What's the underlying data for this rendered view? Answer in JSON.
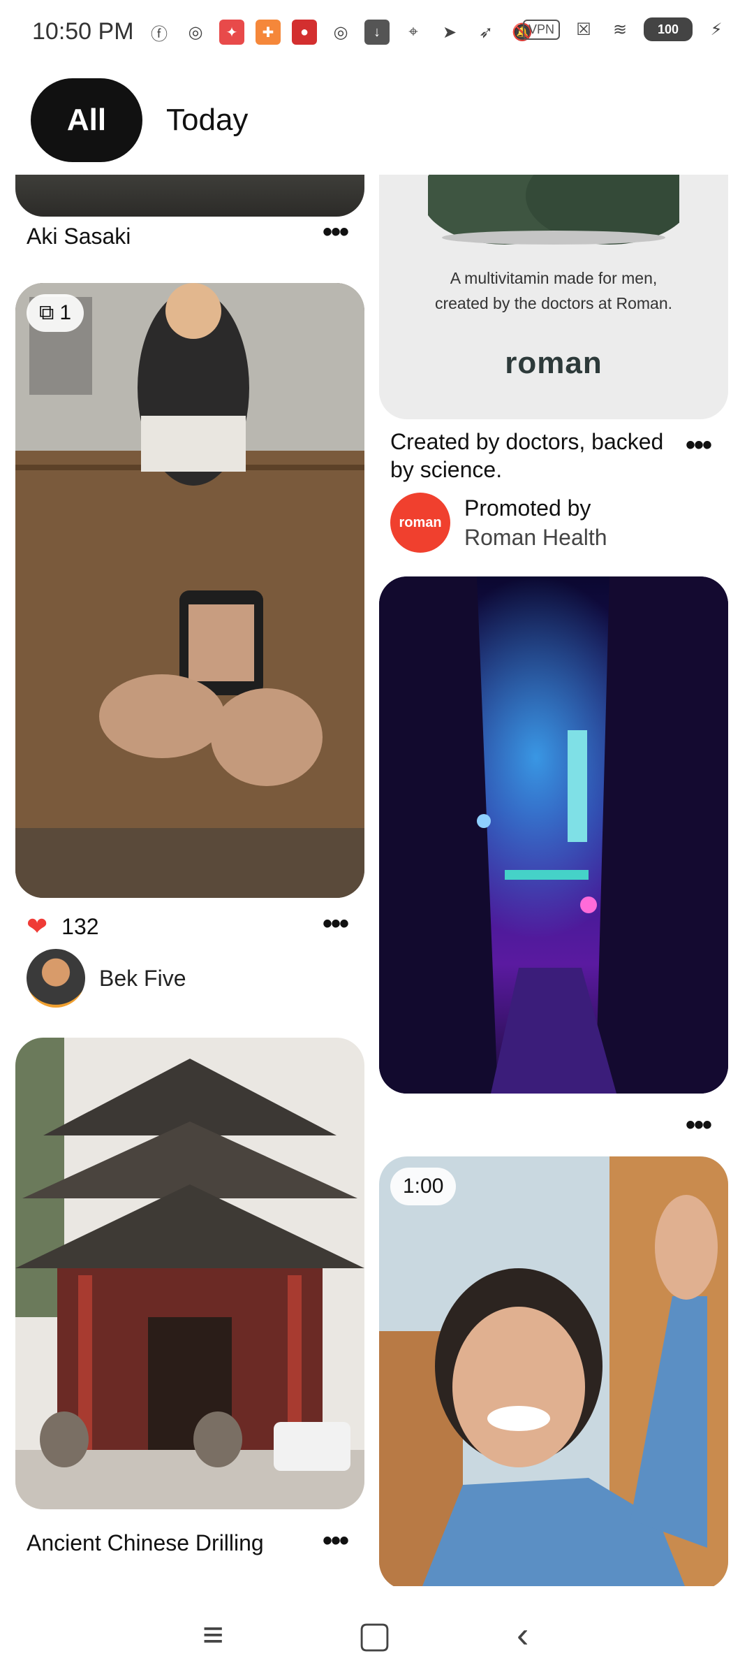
{
  "status": {
    "time": "10:50 PM",
    "icons": [
      "facebook-icon",
      "app-icon",
      "app-icon",
      "app-icon",
      "app-icon",
      "app-icon",
      "download-icon",
      "location-icon",
      "send-icon",
      "navigation-icon",
      "mute-icon"
    ],
    "vpn": "VPN",
    "battery": "100"
  },
  "tabs": [
    {
      "label": "All",
      "selected": true
    },
    {
      "label": "Today",
      "selected": false
    }
  ],
  "feed": {
    "left": [
      {
        "title": "Aki Sasaki"
      },
      {
        "badge": "1",
        "likes": "132",
        "author": "Bek Five"
      },
      {
        "title": "Ancient Chinese Drilling"
      }
    ],
    "right": [
      {
        "ad_line1": "A multivitamin made for men,",
        "ad_line2": "created by the doctors at Roman.",
        "brand": "roman",
        "title_line1": "Created by doctors, backed",
        "title_line2": "by science.",
        "promoted_label": "Promoted by",
        "promoted_by": "Roman Health",
        "avatar_text": "roman"
      },
      {
        "title": ""
      },
      {
        "duration": "1:00"
      }
    ]
  },
  "colors": {
    "brand_red": "#f0402e",
    "text": "#111111",
    "heart": "#ef3b36"
  }
}
